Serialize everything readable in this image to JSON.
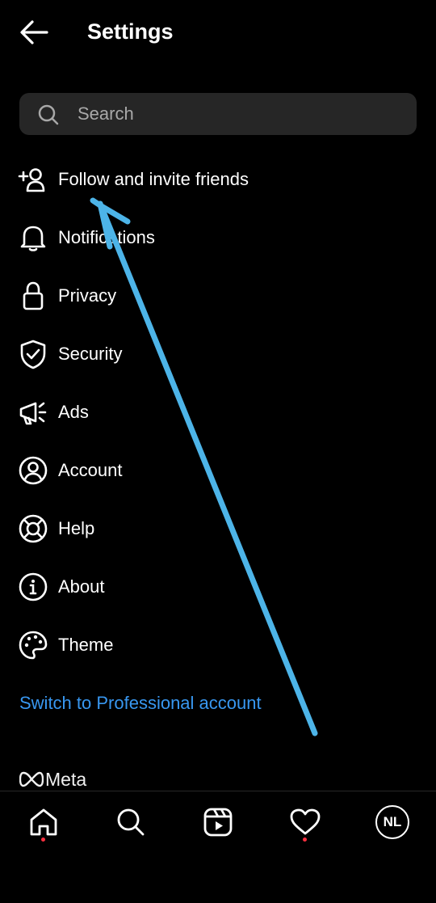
{
  "header": {
    "title": "Settings",
    "back_icon": "arrow-left-icon"
  },
  "search": {
    "placeholder": "Search"
  },
  "menu": [
    {
      "label": "Follow and invite friends",
      "icon": "add-person-icon"
    },
    {
      "label": "Notifications",
      "icon": "bell-icon"
    },
    {
      "label": "Privacy",
      "icon": "lock-icon"
    },
    {
      "label": "Security",
      "icon": "shield-check-icon"
    },
    {
      "label": "Ads",
      "icon": "megaphone-icon"
    },
    {
      "label": "Account",
      "icon": "account-circle-icon"
    },
    {
      "label": "Help",
      "icon": "lifebuoy-icon"
    },
    {
      "label": "About",
      "icon": "info-icon"
    },
    {
      "label": "Theme",
      "icon": "palette-icon"
    }
  ],
  "switch_link": "Switch to Professional account",
  "meta": {
    "brand": "Meta"
  },
  "bottom_nav": {
    "avatar_initials": "NL"
  },
  "colors": {
    "background": "#000000",
    "link": "#3897f0",
    "annotation_arrow": "#4db4e8",
    "notification_dot": "#ff3040",
    "search_bg": "#262626"
  }
}
